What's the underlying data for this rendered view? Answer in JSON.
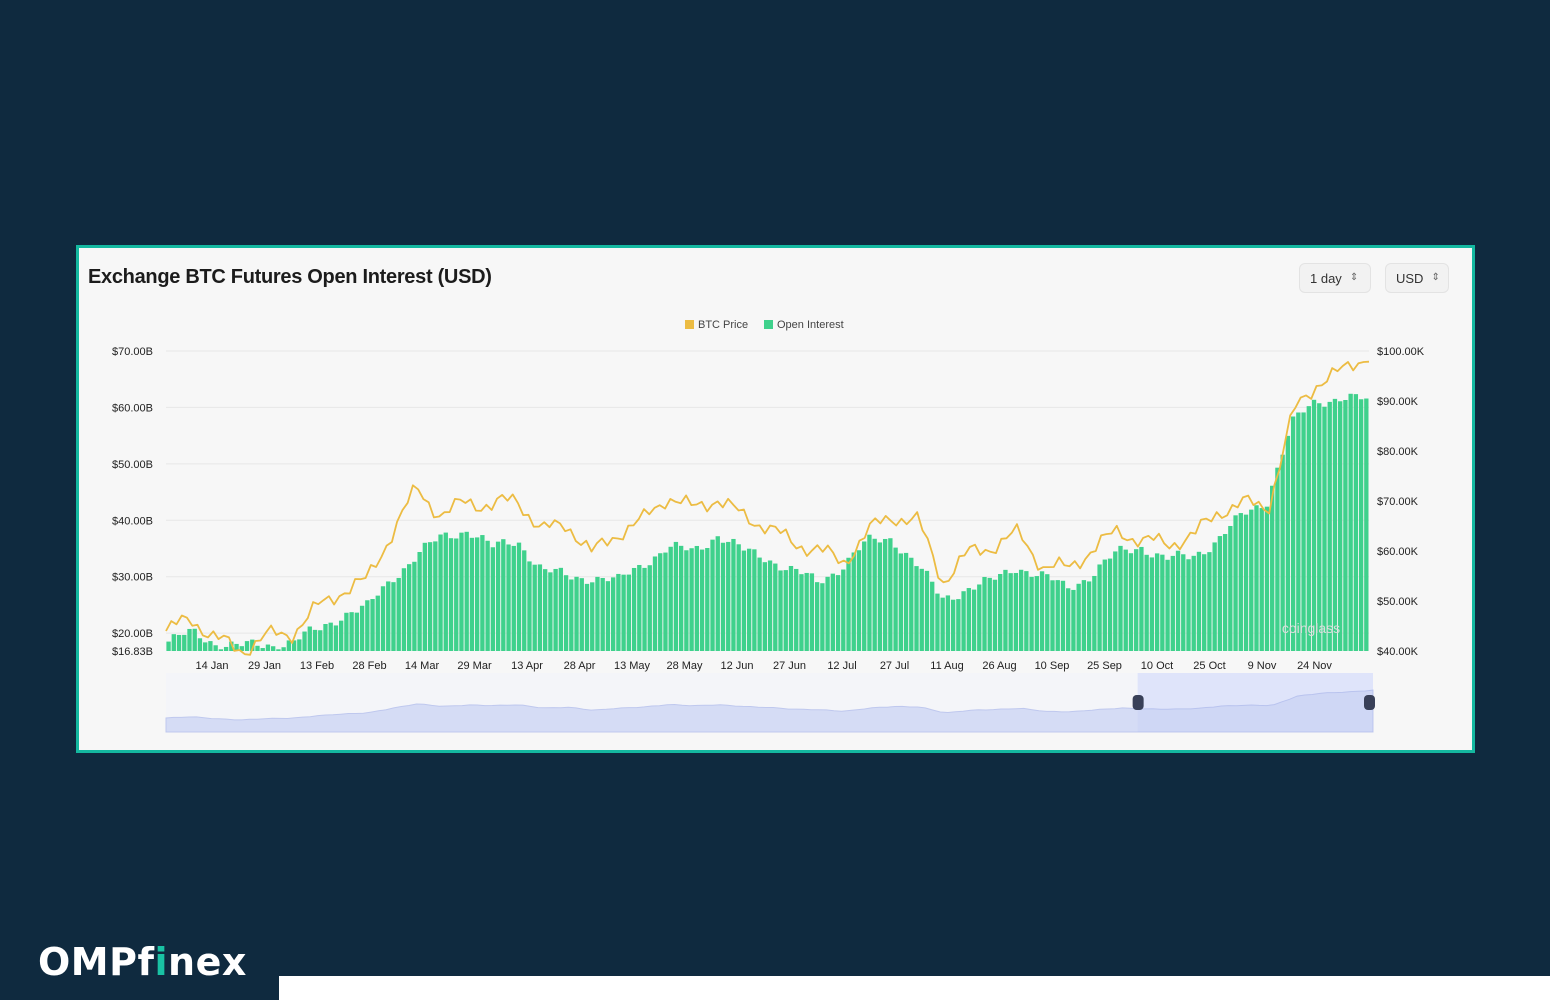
{
  "title": "Exchange BTC Futures Open Interest (USD)",
  "controls": {
    "interval": "1 day",
    "currency": "USD"
  },
  "brand": {
    "part1": "OMPf",
    "part2": "i",
    "part3": "nex"
  },
  "colors": {
    "background": "#0f2a3f",
    "frame_border": "#14b8a0",
    "btc_price": "#ecbc43",
    "open_interest": "#3fd18c",
    "brand_accent": "#19c2a4"
  },
  "chart_data": {
    "type": "bar",
    "title": "Exchange BTC Futures Open Interest (USD)",
    "legend": [
      "BTC Price",
      "Open Interest"
    ],
    "legend_position": "top-center",
    "x_tick_labels": [
      "14 Jan",
      "29 Jan",
      "13 Feb",
      "28 Feb",
      "14 Mar",
      "29 Mar",
      "13 Apr",
      "28 Apr",
      "13 May",
      "28 May",
      "12 Jun",
      "27 Jun",
      "12 Jul",
      "27 Jul",
      "11 Aug",
      "26 Aug",
      "10 Sep",
      "25 Sep",
      "10 Oct",
      "25 Oct",
      "9 Nov",
      "24 Nov"
    ],
    "y_left": {
      "tick_labels": [
        "$16.83B",
        "$20.00B",
        "$30.00B",
        "$40.00B",
        "$50.00B",
        "$60.00B",
        "$70.00B"
      ],
      "range": [
        16.83,
        70
      ]
    },
    "y_right": {
      "tick_labels": [
        "$40.00K",
        "$50.00K",
        "$60.00K",
        "$70.00K",
        "$80.00K",
        "$90.00K",
        "$100.00K"
      ],
      "range": [
        40,
        100
      ]
    },
    "grid": "horizontal",
    "series": [
      {
        "name": "Open Interest",
        "type": "bar",
        "axis": "left",
        "unit": "$B",
        "x": [
          "1 Jan",
          "8 Jan",
          "15 Jan",
          "22 Jan",
          "29 Jan",
          "5 Feb",
          "12 Feb",
          "19 Feb",
          "26 Feb",
          "4 Mar",
          "11 Mar",
          "18 Mar",
          "25 Mar",
          "1 Apr",
          "8 Apr",
          "15 Apr",
          "22 Apr",
          "29 Apr",
          "6 May",
          "13 May",
          "20 May",
          "27 May",
          "3 Jun",
          "10 Jun",
          "17 Jun",
          "24 Jun",
          "1 Jul",
          "8 Jul",
          "15 Jul",
          "22 Jul",
          "29 Jul",
          "5 Aug",
          "12 Aug",
          "19 Aug",
          "26 Aug",
          "2 Sep",
          "9 Sep",
          "16 Sep",
          "23 Sep",
          "30 Sep",
          "7 Oct",
          "14 Oct",
          "21 Oct",
          "28 Oct",
          "4 Nov",
          "11 Nov",
          "18 Nov",
          "25 Nov",
          "30 Nov"
        ],
        "values": [
          18.5,
          20.0,
          18.2,
          17.5,
          18.0,
          18.5,
          20.5,
          23.5,
          24.5,
          30.0,
          34.0,
          37.0,
          38.5,
          35.0,
          36.5,
          31.0,
          30.0,
          30.0,
          29.0,
          32.5,
          35.0,
          34.5,
          37.5,
          34.5,
          33.5,
          31.0,
          29.0,
          32.0,
          36.0,
          37.0,
          32.0,
          26.0,
          28.0,
          29.0,
          32.0,
          30.0,
          28.0,
          30.5,
          34.0,
          35.5,
          33.0,
          33.5,
          36.5,
          40.5,
          43.5,
          57.0,
          61.0,
          62.0,
          61.0
        ]
      },
      {
        "name": "BTC Price",
        "type": "line",
        "axis": "right",
        "unit": "$K",
        "x": [
          "1 Jan",
          "8 Jan",
          "15 Jan",
          "22 Jan",
          "29 Jan",
          "5 Feb",
          "12 Feb",
          "19 Feb",
          "26 Feb",
          "4 Mar",
          "11 Mar",
          "18 Mar",
          "25 Mar",
          "1 Apr",
          "8 Apr",
          "15 Apr",
          "22 Apr",
          "29 Apr",
          "6 May",
          "13 May",
          "20 May",
          "27 May",
          "3 Jun",
          "10 Jun",
          "17 Jun",
          "24 Jun",
          "1 Jul",
          "8 Jul",
          "15 Jul",
          "22 Jul",
          "29 Jul",
          "5 Aug",
          "12 Aug",
          "19 Aug",
          "26 Aug",
          "2 Sep",
          "9 Sep",
          "16 Sep",
          "23 Sep",
          "30 Sep",
          "7 Oct",
          "14 Oct",
          "21 Oct",
          "28 Oct",
          "4 Nov",
          "11 Nov",
          "18 Nov",
          "25 Nov",
          "30 Nov"
        ],
        "values": [
          44.0,
          46.5,
          42.5,
          40.0,
          43.0,
          43.5,
          48.5,
          52.0,
          54.0,
          63.5,
          72.5,
          67.0,
          70.0,
          69.0,
          70.5,
          64.0,
          65.5,
          59.5,
          63.5,
          66.0,
          71.0,
          68.5,
          70.5,
          67.0,
          65.0,
          61.5,
          60.5,
          57.5,
          64.0,
          67.0,
          66.0,
          54.0,
          59.5,
          61.0,
          63.5,
          57.0,
          56.5,
          60.5,
          64.0,
          62.0,
          61.5,
          63.0,
          68.0,
          69.5,
          69.0,
          88.0,
          94.0,
          96.0,
          99.5
        ]
      }
    ],
    "navigator": {
      "present": true,
      "selected_range": [
        "7 Oct",
        "30 Nov"
      ]
    },
    "watermark": "coinglass"
  }
}
